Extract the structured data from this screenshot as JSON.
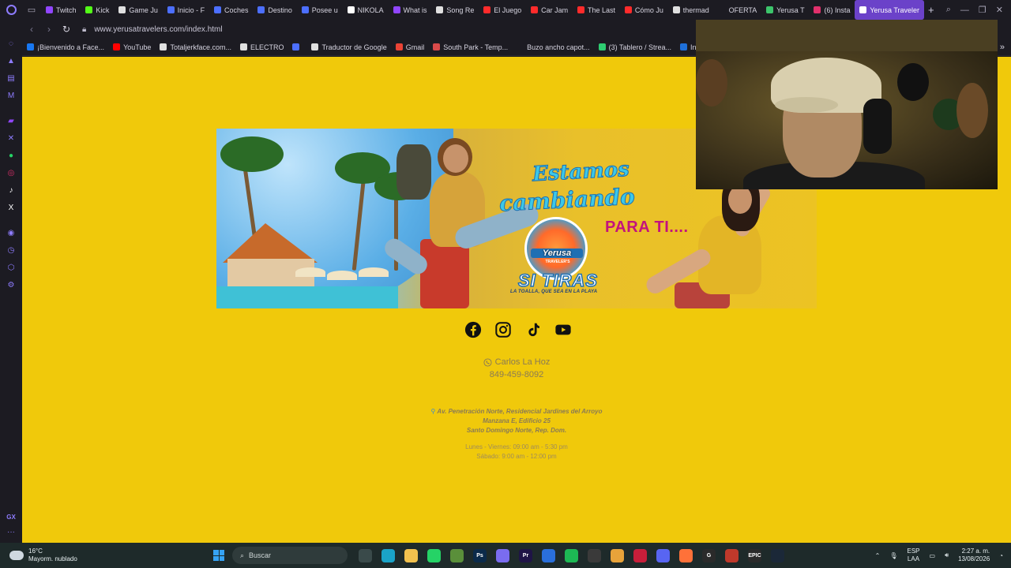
{
  "browser": {
    "tabs": [
      {
        "label": "Twitch",
        "color": "#9146ff"
      },
      {
        "label": "Kick",
        "color": "#53fc18"
      },
      {
        "label": "Game Ju",
        "color": "#e0e0e0"
      },
      {
        "label": "Inicio - F",
        "color": "#4c6fff"
      },
      {
        "label": "Coches",
        "color": "#4c6fff"
      },
      {
        "label": "Destino",
        "color": "#4c6fff"
      },
      {
        "label": "Posee u",
        "color": "#4c6fff"
      },
      {
        "label": "NIKOLA",
        "color": "#ffffff"
      },
      {
        "label": "What is",
        "color": "#9146ff"
      },
      {
        "label": "Song Re",
        "color": "#e0e0e0"
      },
      {
        "label": "El Juego",
        "color": "#ff2b2b"
      },
      {
        "label": "Car Jam",
        "color": "#ff2b2b"
      },
      {
        "label": "The Last",
        "color": "#ff2b2b"
      },
      {
        "label": "Cómo Ju",
        "color": "#ff2b2b"
      },
      {
        "label": "thermad",
        "color": "#e0e0e0"
      },
      {
        "label": "OFERTA",
        "color": "#1c1b22"
      },
      {
        "label": "Yerusa T",
        "color": "#3cc46b"
      },
      {
        "label": "(6) Insta",
        "color": "#e1306c"
      },
      {
        "label": "Yerusa Traveler",
        "color": "#ffffff",
        "active": true
      }
    ],
    "url": "www.yerusatravelers.com/index.html",
    "bookmarks": [
      {
        "label": "¡Bienvenido a Face...",
        "color": "#1877f2"
      },
      {
        "label": "YouTube",
        "color": "#ff0000"
      },
      {
        "label": "Totaljerkface.com...",
        "color": "#e0e0e0"
      },
      {
        "label": "ELECTRO",
        "color": "#e0e0e0"
      },
      {
        "label": "",
        "color": "#4c6fff"
      },
      {
        "label": "Traductor de Google",
        "color": "#e0e0e0"
      },
      {
        "label": "Gmail",
        "color": "#ea4335"
      },
      {
        "label": "South Park - Temp...",
        "color": "#d94a4a"
      },
      {
        "label": "Buzo ancho capot...",
        "color": "#1c1b22"
      },
      {
        "label": "(3) Tablero / Strea...",
        "color": "#2ecc71"
      },
      {
        "label": "Intel Play",
        "color": "#1e6fd9"
      }
    ]
  },
  "page": {
    "banner": {
      "headline_line1": "Estamos",
      "headline_line2": "cambiando",
      "headline_line3": "PARA TI....",
      "logo_name": "Yerusa",
      "logo_sub": "TRAVELER'S",
      "slogan": "SI TIRAS",
      "slogan_sub": "LA TOALLA, QUE SEA EN LA PLAYA"
    },
    "socials": [
      "facebook-icon",
      "instagram-icon",
      "tiktok-icon",
      "youtube-icon"
    ],
    "contact_name": "Carlos La Hoz",
    "contact_phone": "849-459-8092",
    "address": {
      "line1": "Av. Penetración Norte, Residencial Jardines del Arroyo",
      "line2": "Manzana E, Edificio 25",
      "line3": "Santo Domingo Norte, Rep. Dom."
    },
    "hours": {
      "line1": "Lunes - Viernes: 09:00 am - 5:30 pm",
      "line2": "Sábado: 9:00 am - 12:00 pm"
    }
  },
  "taskbar": {
    "weather_temp": "16°C",
    "weather_desc": "Mayorm. nublado",
    "search_placeholder": "Buscar",
    "lang_line1": "ESP",
    "lang_line2": "LAA",
    "time": "2:27 a. m.",
    "date": "13/08/2026",
    "apps": [
      {
        "name": "task-view",
        "color": "#3a4a4a",
        "label": ""
      },
      {
        "name": "edge",
        "color": "#1aa3c8",
        "label": ""
      },
      {
        "name": "file-explorer",
        "color": "#f2c14e",
        "label": ""
      },
      {
        "name": "whatsapp",
        "color": "#25d366",
        "label": ""
      },
      {
        "name": "minecraft",
        "color": "#5a8f3a",
        "label": ""
      },
      {
        "name": "photoshop",
        "color": "#0b2a4a",
        "label": "Ps"
      },
      {
        "name": "copilot",
        "color": "#7a6cf0",
        "label": ""
      },
      {
        "name": "premiere",
        "color": "#1f1446",
        "label": "Pr"
      },
      {
        "name": "store",
        "color": "#2a6fdb",
        "label": ""
      },
      {
        "name": "spotify",
        "color": "#1db954",
        "label": ""
      },
      {
        "name": "xbox",
        "color": "#3a3a3a",
        "label": ""
      },
      {
        "name": "chrome",
        "color": "#e8a33a",
        "label": ""
      },
      {
        "name": "opera-gx",
        "color": "#c81e3a",
        "label": ""
      },
      {
        "name": "discord",
        "color": "#5865f2",
        "label": ""
      },
      {
        "name": "firefox",
        "color": "#ff7139",
        "label": ""
      },
      {
        "name": "logitech",
        "color": "#2a2a2a",
        "label": "G"
      },
      {
        "name": "voicemod",
        "color": "#c0392b",
        "label": ""
      },
      {
        "name": "epic-games",
        "color": "#2a2a2a",
        "label": "EPIC"
      },
      {
        "name": "steam",
        "color": "#1b2838",
        "label": ""
      }
    ]
  },
  "colors": {
    "page_bg": "#f0c90b",
    "accent_purple": "#6b42c9",
    "contact_text": "#8a7a55"
  }
}
